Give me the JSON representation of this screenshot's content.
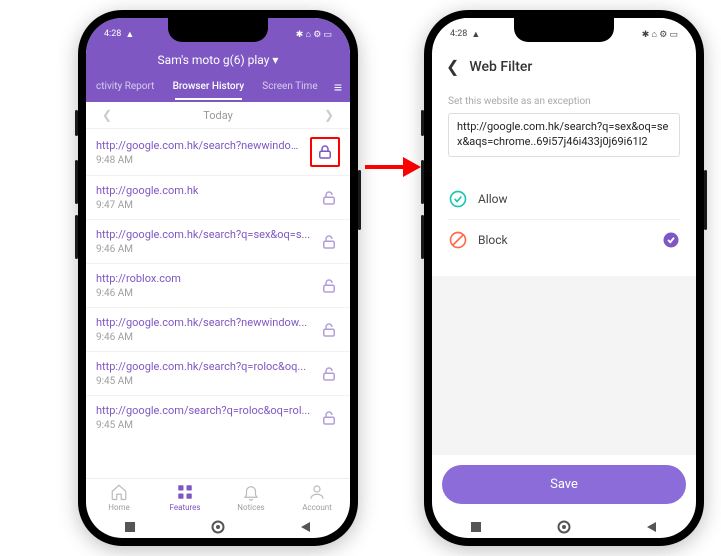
{
  "status": {
    "time": "4:28",
    "warn": "▲"
  },
  "left": {
    "device_name": "Sam's moto g(6) play ▾",
    "tabs": {
      "activity": "ctivity Report",
      "history": "Browser History",
      "screentime": "Screen Time"
    },
    "date_label": "Today",
    "history": [
      {
        "url": "http://google.com.hk/search?newwindow...",
        "time": "9:48 AM"
      },
      {
        "url": "http://google.com.hk",
        "time": "9:47 AM"
      },
      {
        "url": "http://google.com.hk/search?q=sex&oq=s...",
        "time": "9:46 AM"
      },
      {
        "url": "http://roblox.com",
        "time": "9:46 AM"
      },
      {
        "url": "http://google.com.hk/search?newwindow...",
        "time": "9:46 AM"
      },
      {
        "url": "http://google.com.hk/search?q=roloc&oq...",
        "time": "9:45 AM"
      },
      {
        "url": "http://google.com/search?q=roloc&oq=rol...",
        "time": "9:45 AM"
      }
    ],
    "bottom": {
      "home": "Home",
      "features": "Features",
      "notices": "Notices",
      "account": "Account"
    }
  },
  "right": {
    "title": "Web Filter",
    "hint": "Set this website as an exception",
    "url_value": "http://google.com.hk/search?q=sex&oq=sex&aqs=chrome..69i57j46i433j0j69i61l2",
    "allow_label": "Allow",
    "block_label": "Block",
    "save_label": "Save"
  }
}
